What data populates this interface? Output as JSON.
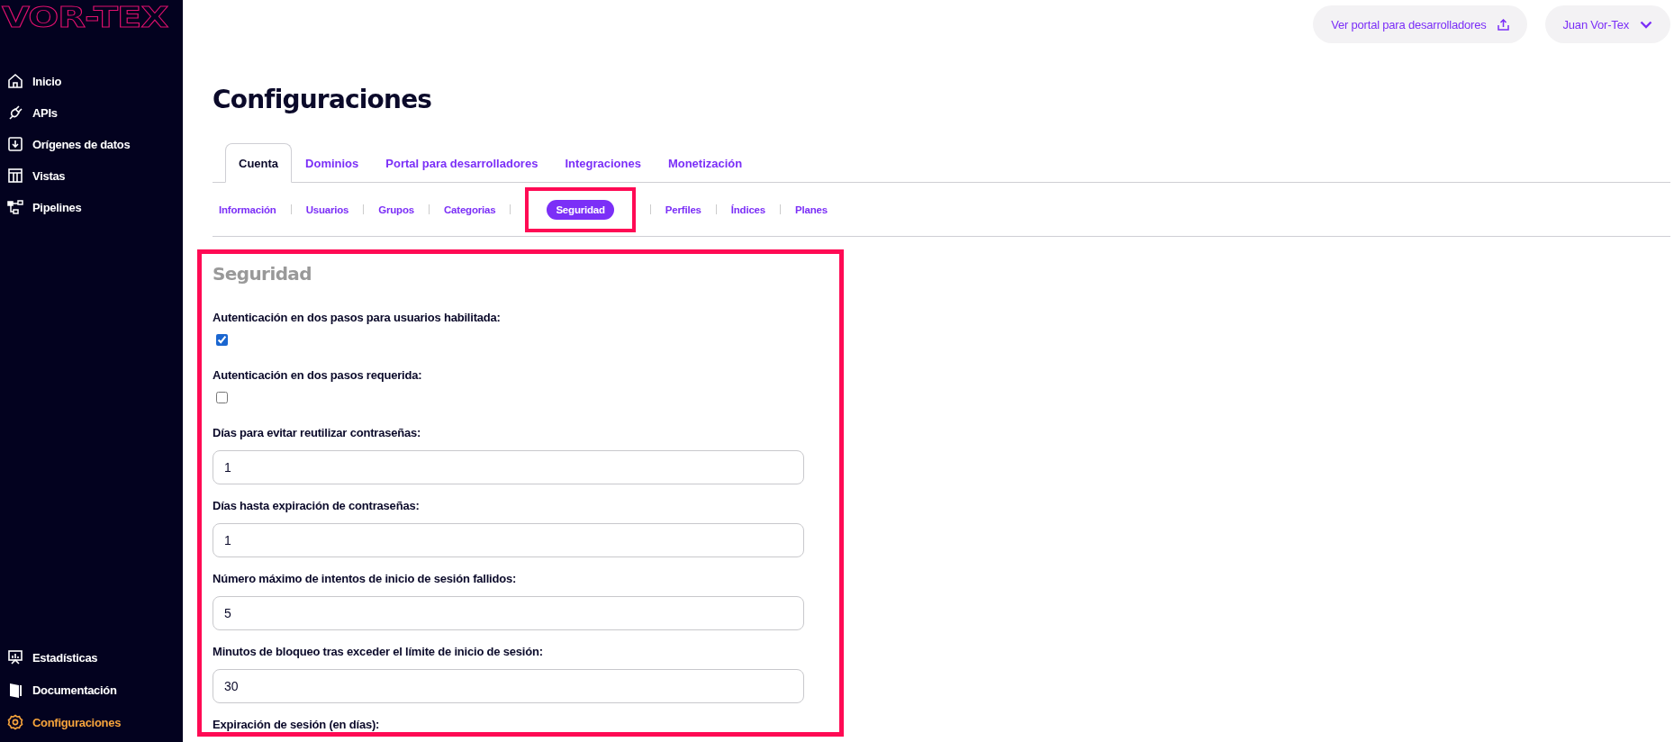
{
  "sidebar": {
    "logo": "VOR-TEX",
    "items": [
      {
        "label": "Inicio",
        "selected": false
      },
      {
        "label": "APIs",
        "selected": false
      },
      {
        "label": "Orígenes de datos",
        "selected": false
      },
      {
        "label": "Vistas",
        "selected": false
      },
      {
        "label": "Pipelines",
        "selected": false
      }
    ],
    "bottom_items": [
      {
        "label": "Estadísticas",
        "selected": false
      },
      {
        "label": "Documentación",
        "selected": false
      },
      {
        "label": "Configuraciones",
        "selected": true
      }
    ]
  },
  "header": {
    "portal_button": "Ver portal para desarrolladores",
    "user_menu": "Juan Vor-Tex"
  },
  "title": "Configuraciones",
  "tabs": [
    {
      "label": "Cuenta",
      "selected": true
    },
    {
      "label": "Dominios",
      "selected": false
    },
    {
      "label": "Portal para desarrolladores",
      "selected": false
    },
    {
      "label": "Integraciones",
      "selected": false
    },
    {
      "label": "Monetización",
      "selected": false
    }
  ],
  "subtabs": [
    {
      "label": "Información",
      "selected": false
    },
    {
      "label": "Usuarios",
      "selected": false
    },
    {
      "label": "Grupos",
      "selected": false
    },
    {
      "label": "Categorias",
      "selected": false
    },
    {
      "label": "Seguridad",
      "selected": true
    },
    {
      "label": "Perfiles",
      "selected": false
    },
    {
      "label": "Índices",
      "selected": false
    },
    {
      "label": "Planes",
      "selected": false
    }
  ],
  "section": {
    "heading": "Seguridad",
    "fields": [
      {
        "kind": "checkbox",
        "label": "Autenticación en dos pasos para usuarios habilitada:",
        "checked": true
      },
      {
        "kind": "checkbox",
        "label": "Autenticación en dos pasos requerida:",
        "checked": false
      },
      {
        "kind": "number",
        "label": "Días para evitar reutilizar contraseñas:",
        "value": "1"
      },
      {
        "kind": "number",
        "label": "Días hasta expiración de contraseñas:",
        "value": "1"
      },
      {
        "kind": "number",
        "label": "Número máximo de intentos de inicio de sesión fallidos:",
        "value": "5"
      },
      {
        "kind": "number",
        "label": "Minutos de bloqueo tras exceder el límite de inicio de sesión:",
        "value": "30"
      },
      {
        "kind": "number",
        "label": "Expiración de sesión (en días):"
      }
    ]
  }
}
